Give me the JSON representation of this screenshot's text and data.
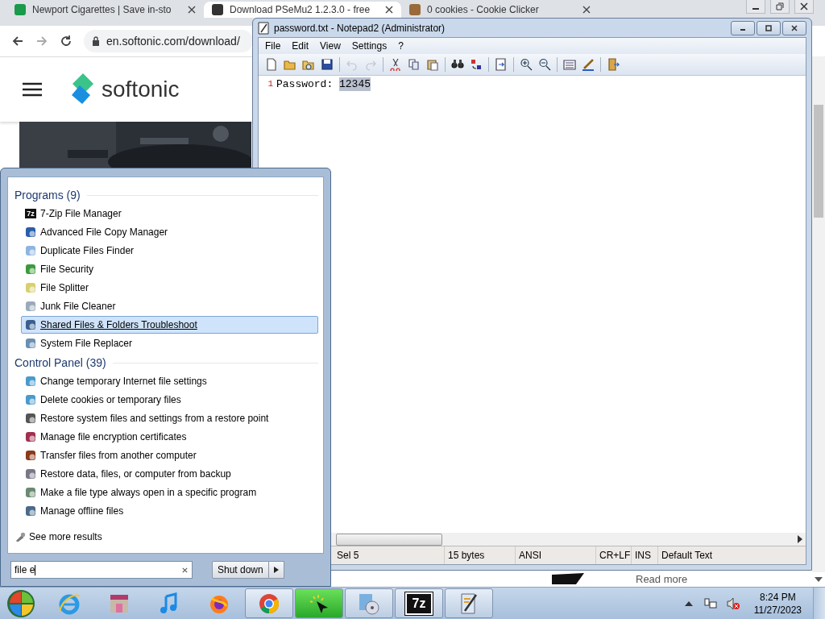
{
  "browser": {
    "tabs": [
      {
        "title": "Newport Cigarettes | Save in-sto",
        "selected": false
      },
      {
        "title": "Download PSeMu2 1.2.3.0 - free",
        "selected": true
      },
      {
        "title": "0 cookies - Cookie Clicker",
        "selected": false
      }
    ],
    "url": "en.softonic.com/download/",
    "site_name": "softonic",
    "read_more": "Read more"
  },
  "notepad": {
    "title": "password.txt - Notepad2 (Administrator)",
    "menu": [
      "File",
      "Edit",
      "View",
      "Settings",
      "?"
    ],
    "toolbar": [
      [
        {
          "kind": "new",
          "disabled": false
        },
        {
          "kind": "open",
          "disabled": false
        },
        {
          "kind": "browse",
          "disabled": false
        },
        {
          "kind": "save",
          "disabled": false
        }
      ],
      [
        {
          "kind": "undo",
          "disabled": true
        },
        {
          "kind": "redo",
          "disabled": true
        }
      ],
      [
        {
          "kind": "cut",
          "disabled": false
        },
        {
          "kind": "copy",
          "disabled": false
        },
        {
          "kind": "paste",
          "disabled": false
        }
      ],
      [
        {
          "kind": "find",
          "disabled": false
        },
        {
          "kind": "replace",
          "disabled": false
        }
      ],
      [
        {
          "kind": "wrap",
          "disabled": false
        }
      ],
      [
        {
          "kind": "zoomin",
          "disabled": false
        },
        {
          "kind": "zoomout",
          "disabled": false
        }
      ],
      [
        {
          "kind": "scheme",
          "disabled": false
        },
        {
          "kind": "customize",
          "disabled": false
        }
      ],
      [
        {
          "kind": "exit",
          "disabled": false
        }
      ]
    ],
    "lines": [
      {
        "number": "1",
        "text": "Password: ",
        "selected_text": "12345"
      }
    ],
    "status": [
      "Sel 5",
      "15 bytes",
      "ANSI",
      "CR+LF",
      "INS",
      "Default Text"
    ]
  },
  "start_menu": {
    "groups": [
      {
        "heading": "Programs (9)",
        "items": [
          {
            "label": "7-Zip File Manager",
            "icon_text": "7z",
            "selected": false
          },
          {
            "label": "Advanced File Copy Manager",
            "selected": false
          },
          {
            "label": "Duplicate Files Finder",
            "selected": false
          },
          {
            "label": "File Security",
            "selected": false
          },
          {
            "label": "File Splitter",
            "selected": false
          },
          {
            "label": "Junk File Cleaner",
            "selected": false
          },
          {
            "label": "Shared Files & Folders Troubleshoot",
            "selected": true
          },
          {
            "label": "System File Replacer",
            "selected": false
          }
        ]
      },
      {
        "heading": "Control Panel (39)",
        "items": [
          {
            "label": "Change temporary Internet file settings",
            "selected": false
          },
          {
            "label": "Delete cookies or temporary files",
            "selected": false
          },
          {
            "label": "Restore system files and settings from a restore point",
            "selected": false
          },
          {
            "label": "Manage file encryption certificates",
            "selected": false
          },
          {
            "label": "Transfer files from another computer",
            "selected": false
          },
          {
            "label": "Restore data, files, or computer from backup",
            "selected": false
          },
          {
            "label": "Make a file type always open in a specific program",
            "selected": false
          },
          {
            "label": "Manage offline files",
            "selected": false
          }
        ]
      }
    ],
    "see_more": "See more results",
    "search": {
      "value": "file e"
    },
    "shutdown": "Shut down"
  },
  "taskbar": {
    "apps": [
      {
        "kind": "ie",
        "running": false,
        "selected": false
      },
      {
        "kind": "store",
        "running": false,
        "selected": false
      },
      {
        "kind": "music",
        "running": false,
        "selected": false
      },
      {
        "kind": "firefox",
        "running": false,
        "selected": false
      },
      {
        "kind": "chrome",
        "running": true,
        "selected": false
      },
      {
        "kind": "cursor",
        "running": true,
        "selected": true
      },
      {
        "kind": "disc",
        "running": true,
        "selected": false
      },
      {
        "kind": "zip",
        "running": true,
        "selected": false,
        "icon_text": "7z"
      },
      {
        "kind": "notepad",
        "running": true,
        "selected": false
      }
    ],
    "clock": {
      "time": "8:24 PM",
      "date": "11/27/2023"
    }
  }
}
